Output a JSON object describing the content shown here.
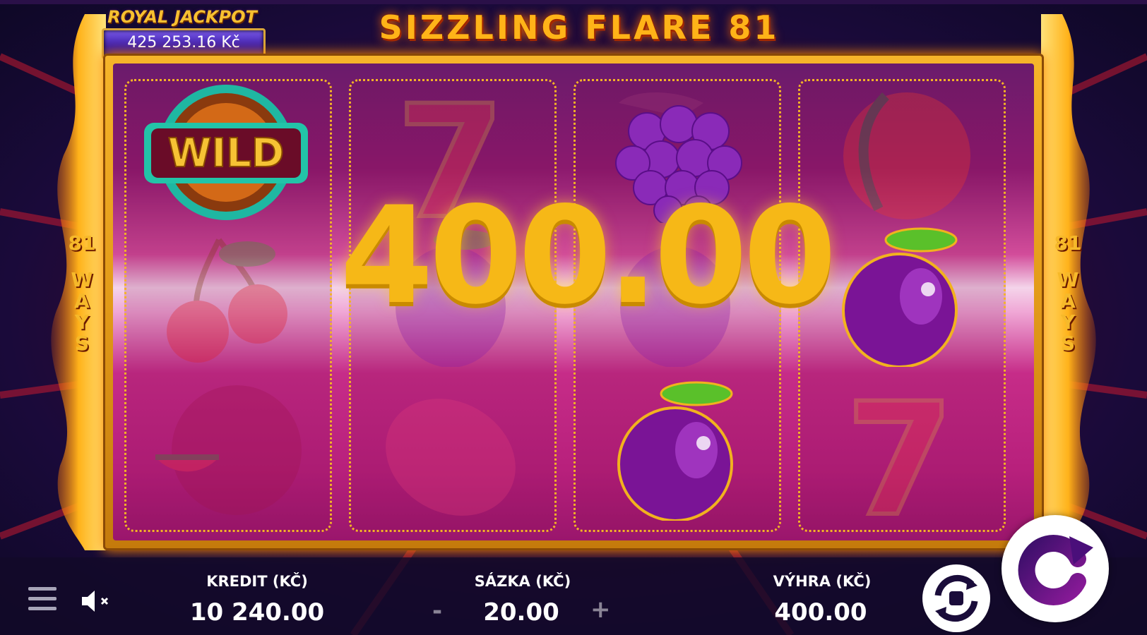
{
  "game": {
    "title": "SIZZLING FLARE 81",
    "ways_number": "81",
    "ways_letters": [
      "W",
      "A",
      "Y",
      "S"
    ]
  },
  "jackpot": {
    "label": "ROYAL JACKPOT",
    "value": "425 253.16 Kč"
  },
  "win_display": "400.00",
  "reels": [
    [
      "wild",
      "cherry",
      "watermelon"
    ],
    [
      "seven",
      "plum",
      "lemon"
    ],
    [
      "grapes",
      "plum",
      "plum"
    ],
    [
      "orange",
      "plum",
      "seven"
    ]
  ],
  "symbol_labels": {
    "wild": "WILD",
    "seven": "7"
  },
  "hud": {
    "credit_label": "KREDIT (KČ)",
    "credit_value": "10 240.00",
    "bet_label": "SÁZKA (KČ)",
    "bet_value": "20.00",
    "bet_minus": "-",
    "bet_plus": "+",
    "win_label": "VÝHRA (KČ)",
    "win_value": "400.00"
  },
  "icons": {
    "menu": "hamburger-menu-icon",
    "sound": "speaker-muted-icon",
    "autoplay": "autoplay-icon",
    "spin": "spin-icon"
  },
  "colors": {
    "gold": "#f6b817",
    "plum": "#8a1fa8",
    "frame": "#e29a18"
  }
}
